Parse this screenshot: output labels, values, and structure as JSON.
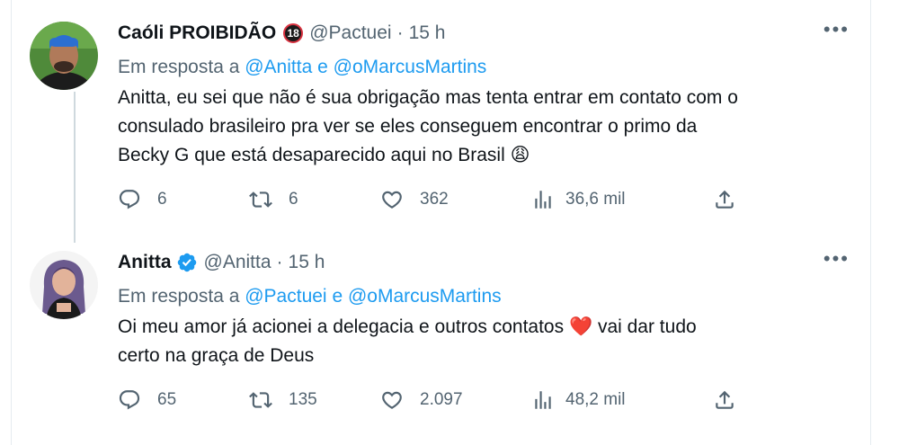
{
  "tweets": [
    {
      "name": "Caóli PROIBIDÃO",
      "badge": "18",
      "handle": "@Pactuei",
      "time": "15 h",
      "reply_prefix": "Em resposta a ",
      "reply_mention_1": "@Anitta",
      "reply_conj": " e ",
      "reply_mention_2": "@oMarcusMartins",
      "text_lines": [
        "Anitta, eu sei que não é sua obrigação mas tenta entrar em contato com o",
        "consulado brasileiro pra ver se eles conseguem encontrar o primo da",
        "Becky G que está desaparecido aqui no Brasil"
      ],
      "emoji": "😩",
      "replies": "6",
      "retweets": "6",
      "likes": "362",
      "views": "36,6 mil"
    },
    {
      "name": "Anitta",
      "verified": true,
      "handle": "@Anitta",
      "time": "15 h",
      "reply_prefix": "Em resposta a ",
      "reply_mention_1": "@Pactuei",
      "reply_conj": " e ",
      "reply_mention_2": "@oMarcusMartins",
      "text_line_1a": "Oi meu amor já acionei a delegacia e outros contatos ",
      "emoji": "❤️",
      "text_line_1b": " vai dar tudo",
      "text_line_2": "certo na graça de Deus",
      "replies": "65",
      "retweets": "135",
      "likes": "2.097",
      "views": "48,2 mil"
    }
  ],
  "icons": {
    "more": "more-icon",
    "reply": "reply-icon",
    "retweet": "retweet-icon",
    "like": "heart-icon",
    "views": "views-icon",
    "share": "share-icon",
    "verified": "verified-badge-icon"
  },
  "colors": {
    "link": "#1d9bf0",
    "secondary": "#536471",
    "verified": "#1d9bf0"
  }
}
